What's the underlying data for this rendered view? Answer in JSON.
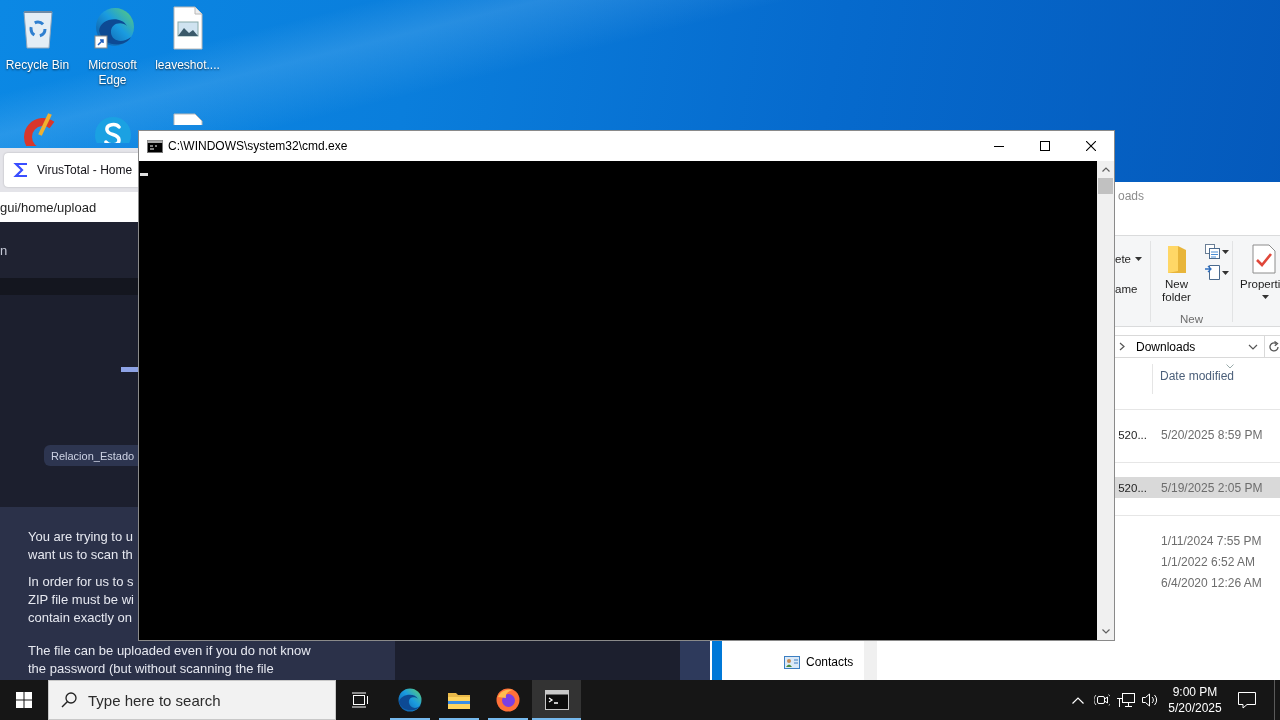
{
  "desktop": {
    "icons": [
      {
        "kind": "recycle-bin",
        "label": "Recycle Bin"
      },
      {
        "kind": "edge",
        "label": "Microsoft Edge"
      },
      {
        "kind": "image-file",
        "label": "leaveshot...."
      },
      {
        "kind": "cleaner"
      },
      {
        "kind": "skype"
      },
      {
        "kind": "document"
      }
    ]
  },
  "browser": {
    "tab": {
      "title": "VirusTotal - Home",
      "selected": true
    },
    "address": "gui/home/upload",
    "header_text": "n",
    "file_chip": "Relacion_Estado",
    "notice": {
      "paragraphs": [
        {
          "lines": [
            "You are trying to u",
            "want us to scan th"
          ]
        },
        {
          "lines": [
            "In order for us to s",
            "ZIP file must be wi",
            "contain exactly on"
          ]
        },
        {
          "lines": [
            "The file can be uploaded even if you do not know",
            "the password (but without scanning the file"
          ]
        }
      ]
    }
  },
  "explorer": {
    "title": "oads",
    "ribbon": {
      "commands": [
        {
          "kind": "dropdown",
          "label": "ete"
        },
        {
          "kind": "plain",
          "label": "ame"
        }
      ],
      "new_group": {
        "label": "New",
        "new_folder": "New folder"
      },
      "properties": "Properti"
    },
    "address": {
      "location": "Downloads"
    },
    "nav_items": [
      {
        "label": "Contacts"
      }
    ],
    "columns": [
      "Date modified"
    ],
    "groups": [
      {
        "rows": [
          {
            "name": "520...",
            "date": "5/20/2025 8:59 PM",
            "selected": false
          }
        ]
      },
      {
        "rows": [
          {
            "name": "520...",
            "date": "5/19/2025 2:05 PM",
            "selected": true
          }
        ]
      },
      {
        "rows": [
          {
            "date": "1/11/2024 7:55 PM",
            "selected": false
          },
          {
            "date": "1/1/2022 6:52 AM",
            "selected": false
          },
          {
            "date": "6/4/2020 12:26 AM",
            "selected": false
          }
        ]
      }
    ]
  },
  "console": {
    "title": "C:\\WINDOWS\\system32\\cmd.exe"
  },
  "taskbar": {
    "search": {
      "placeholder": "Type here to search"
    },
    "apps": [
      {
        "kind": "edge",
        "running": true,
        "selected": false
      },
      {
        "kind": "explorer",
        "running": true,
        "selected": false
      },
      {
        "kind": "firefox",
        "running": true,
        "selected": false
      },
      {
        "kind": "console",
        "running": true,
        "selected": true
      }
    ],
    "clock": {
      "time": "9:00 PM",
      "date": "5/20/2025"
    }
  }
}
